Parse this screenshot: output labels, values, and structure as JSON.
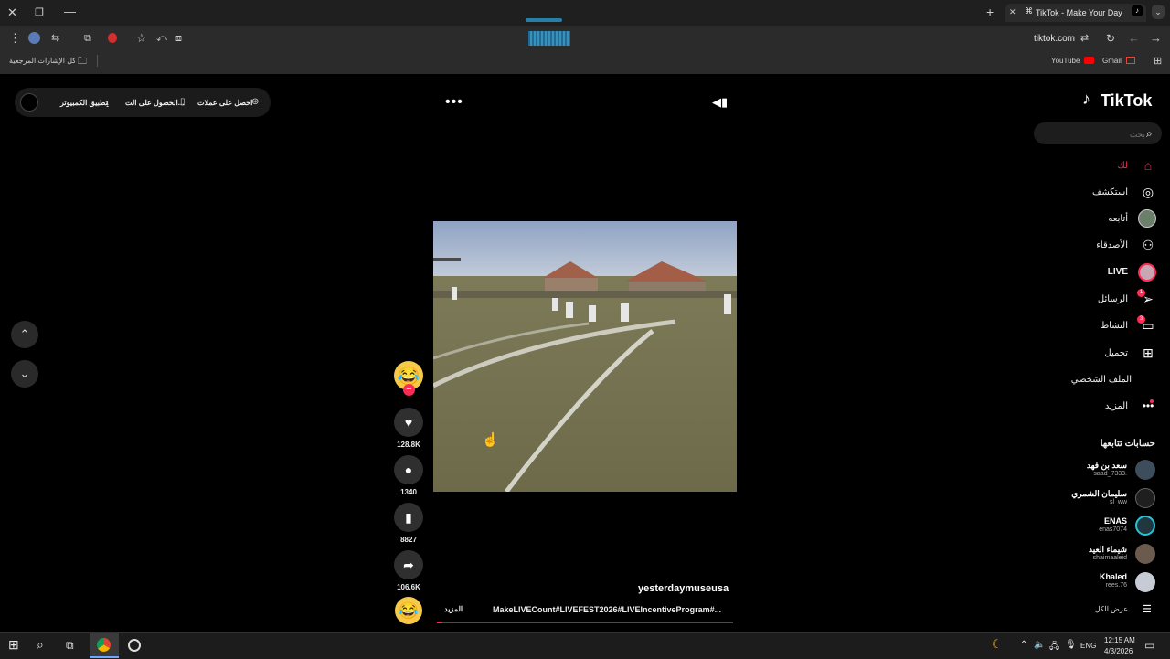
{
  "browser": {
    "tab_title": "TikTok - Make Your Day",
    "url": "tiktok.com",
    "bookmarks_all_label": "كل الإشارات المرجعية",
    "bookmarks": [
      {
        "label": "YouTube"
      },
      {
        "label": "Gmail"
      }
    ]
  },
  "header": {
    "get_coins_label": "احصل على عملات",
    "get_app_label": "الحصول على الت...",
    "desktop_app_label": "تطبيق الكمبيوتر",
    "logo_text": "TikTok"
  },
  "search": {
    "placeholder": "بحث"
  },
  "sidebar": {
    "items": [
      {
        "label": "لك",
        "icon": "home-icon",
        "active": true
      },
      {
        "label": "استكشف",
        "icon": "compass-icon"
      },
      {
        "label": "أتابعه",
        "icon": "following-avatar"
      },
      {
        "label": "الأصدقاء",
        "icon": "friends-icon"
      },
      {
        "label": "LIVE",
        "icon": "live-avatar"
      },
      {
        "label": "الرسائل",
        "icon": "send-icon",
        "badge": "1"
      },
      {
        "label": "النشاط",
        "icon": "chat-icon",
        "badge": "3"
      },
      {
        "label": "تحميل",
        "icon": "upload-icon"
      },
      {
        "label": "الملف الشخصي",
        "icon": "profile-icon"
      },
      {
        "label": "المزيد",
        "icon": "more-icon"
      }
    ],
    "following_title": "حسابات تتابعها",
    "following": [
      {
        "name": "سعد بن فهد",
        "user": "saad_7333."
      },
      {
        "name": "سليمان الشمري",
        "user": "sl_ww"
      },
      {
        "name": "ENAS",
        "user": "enas7074"
      },
      {
        "name": "شيماء العيد",
        "user": "shaimaaleid"
      },
      {
        "name": "Khaled",
        "user": "rees.76"
      }
    ],
    "see_all_label": "عرض الكل"
  },
  "post": {
    "author": "yesterdaymuseusa",
    "caption": "MakeLIVECount#LIVEFEST2026#LIVEIncentiveProgram#...",
    "more_label": "المزيد",
    "likes": "128.8K",
    "comments": "1340",
    "saves": "8827",
    "shares": "106.6K",
    "progress": 0.02
  },
  "taskbar": {
    "language": "ENG",
    "time": "12:15 AM",
    "date": "4/3/2026"
  },
  "colors": {
    "accent": "#fe2c55",
    "background": "#000000"
  }
}
